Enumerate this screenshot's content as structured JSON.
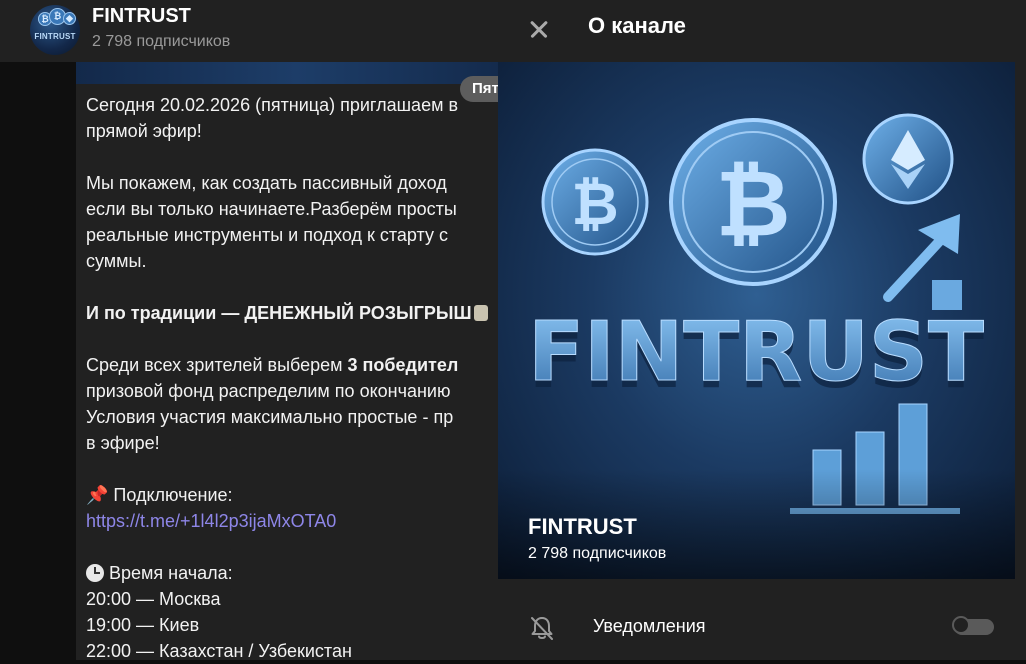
{
  "chat": {
    "title": "FINTRUST",
    "subtitle": "2 798 подписчиков",
    "avatar_text": "FINTRUST",
    "date_pill": "Пят",
    "message": {
      "line1": "Сегодня 20.02.2026 (пятница) приглашаем в",
      "line2": "прямой эфир!",
      "line3": "Мы покажем, как создать пассивный доход",
      "line4": "если вы только начинаете.Разберём просты",
      "line5": "реальные инструменты и подход к старту с",
      "line6": "суммы.",
      "line7": "И по традиции — ДЕНЕЖНЫЙ РОЗЫГРЫШ",
      "line8_normal": "Среди всех зрителей выберем ",
      "line8_bold": "3 победител",
      "line9": "призовой фонд распределим по окончанию",
      "line10": "Условия участия максимально простые - пр",
      "line11": "в эфире!",
      "connect_label": "Подключение:",
      "link": "https://t.me/+1l4l2p3ijaMxOTA0",
      "time_label": "Время начала:",
      "time1": "20:00 — Москва",
      "time2": "19:00 — Киев",
      "time3": "22:00 — Казахстан / Узбекистан"
    }
  },
  "info": {
    "title": "О канале",
    "cover_text": "FINTRUST",
    "channel_name": "FINTRUST",
    "subscribers": "2 798 подписчиков",
    "notifications_label": "Уведомления",
    "notifications_enabled": false
  },
  "colors": {
    "panel_bg": "#212121",
    "chat_bg": "#0f0f0f",
    "link": "#8e86e8",
    "muted": "#9a9a9a"
  },
  "icons": [
    "close-icon",
    "bell-off-icon",
    "pin-icon",
    "clock-icon",
    "bitcoin-icon",
    "ethereum-icon",
    "arrow-up-icon"
  ]
}
